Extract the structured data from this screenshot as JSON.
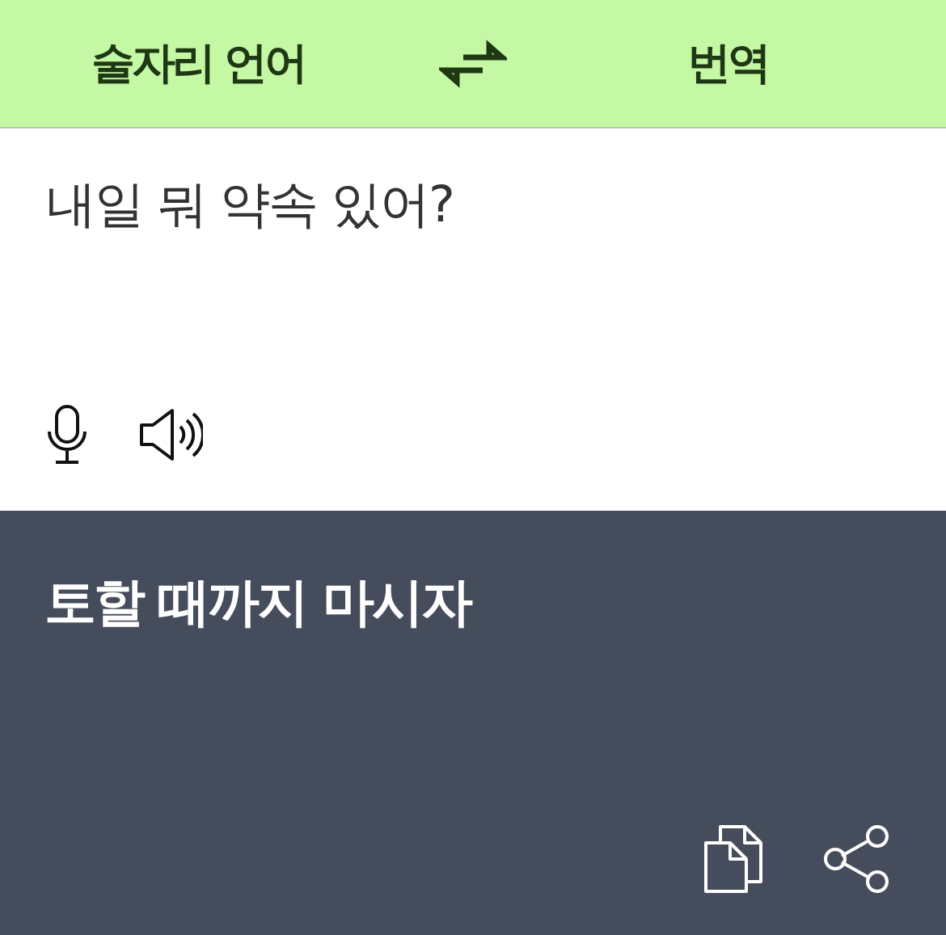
{
  "header": {
    "source_language": "술자리 언어",
    "target_language": "번역"
  },
  "source": {
    "value": "내일 뭐 약속 있어?"
  },
  "result": {
    "text": "토할 때까지 마시자"
  }
}
